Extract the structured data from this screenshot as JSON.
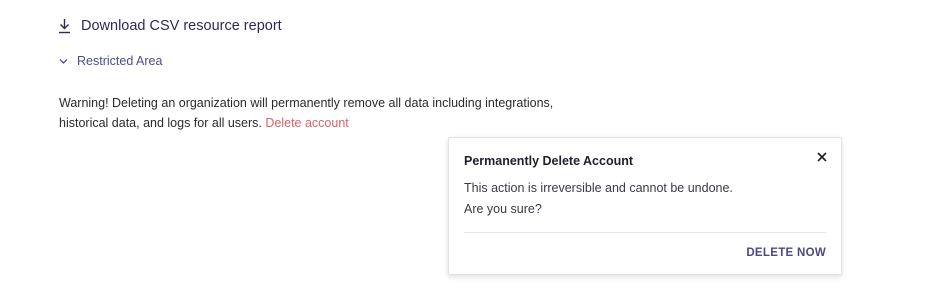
{
  "download": {
    "label": "Download CSV resource report",
    "icon": "download-icon"
  },
  "restricted": {
    "label": "Restricted Area",
    "icon": "chevron-down-icon"
  },
  "warning": {
    "text": "Warning! Deleting an organization will permanently remove all data including integrations, historical data, and logs for all users.",
    "link_label": "Delete account"
  },
  "modal": {
    "title": "Permanently Delete Account",
    "line1": "This action is irreversible and cannot be undone.",
    "line2": "Are you sure?",
    "action_label": "DELETE NOW",
    "close_icon": "close-icon"
  },
  "colors": {
    "accent": "#4c4882",
    "danger_link": "#d9636b",
    "text": "#2b2b2b"
  }
}
